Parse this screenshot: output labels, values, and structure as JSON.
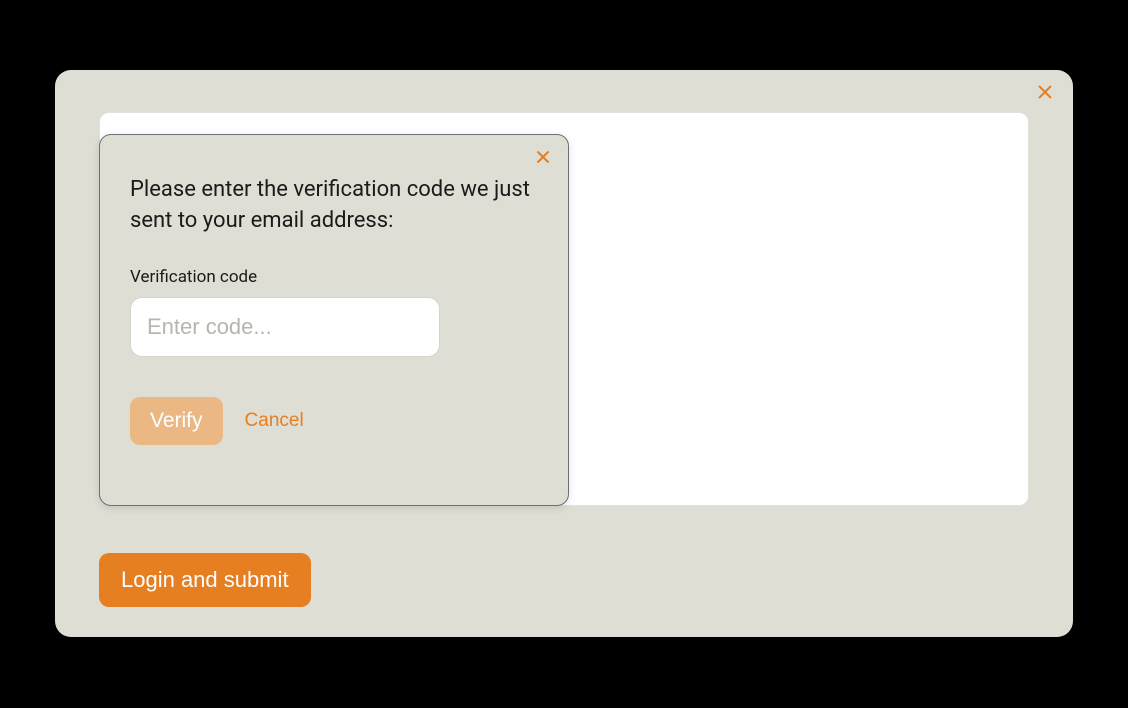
{
  "outer_panel": {
    "login_submit_label": "Login and submit"
  },
  "modal": {
    "heading": "Please enter the verification code we just sent to your email address:",
    "field_label": "Verification code",
    "input_placeholder": "Enter code...",
    "input_value": "",
    "verify_label": "Verify",
    "cancel_label": "Cancel"
  },
  "colors": {
    "accent": "#E67E22",
    "panel_bg": "#DFDED4",
    "verify_bg_disabled": "#EBB884"
  }
}
